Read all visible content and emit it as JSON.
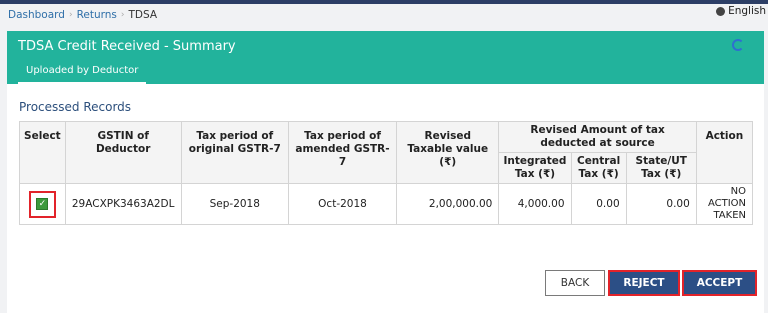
{
  "breadcrumb": {
    "items": [
      "Dashboard",
      "Returns"
    ],
    "current": "TDSA"
  },
  "language": {
    "label": "English"
  },
  "panel": {
    "title": "TDSA Credit Received - Summary",
    "tab": "Uploaded by Deductor"
  },
  "section_title": "Processed Records",
  "table": {
    "headers": {
      "select": "Select",
      "gstin": "GSTIN of Deductor",
      "orig_period": "Tax period of original GSTR-7",
      "amend_period": "Tax period of amended GSTR-7",
      "taxable": "Revised Taxable value (₹)",
      "revised_group": "Revised Amount of tax deducted at source",
      "integrated": "Integrated Tax (₹)",
      "central": "Central Tax (₹)",
      "state": "State/UT Tax (₹)",
      "action": "Action"
    },
    "rows": [
      {
        "selected": true,
        "gstin": "29ACXPK3463A2DL",
        "orig_period": "Sep-2018",
        "amend_period": "Oct-2018",
        "taxable": "2,00,000.00",
        "integrated": "4,000.00",
        "central": "0.00",
        "state": "0.00",
        "action": "NO ACTION TAKEN"
      }
    ]
  },
  "buttons": {
    "back": "BACK",
    "reject": "REJECT",
    "accept": "ACCEPT"
  },
  "colors": {
    "header_bg": "#22b39c",
    "primary_button": "#2c4f86",
    "highlight": "#e2232a"
  }
}
